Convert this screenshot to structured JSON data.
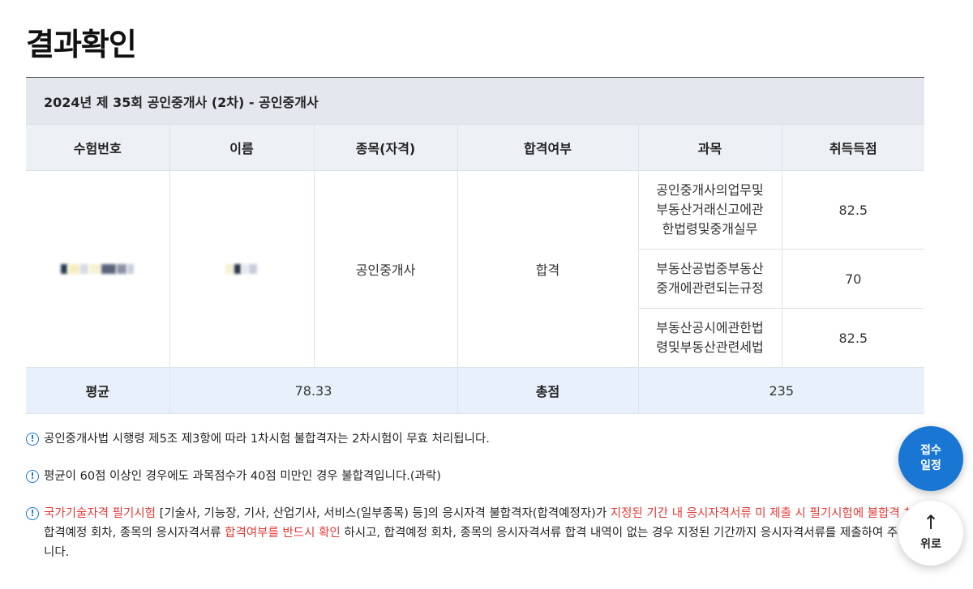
{
  "page": {
    "title": "결과확인"
  },
  "exam": {
    "caption": "2024년 제 35회 공인중개사 (2차) - 공인중개사"
  },
  "table": {
    "headers": [
      "수험번호",
      "이름",
      "종목(자격)",
      "합격여부",
      "과목",
      "취득득점"
    ],
    "result": {
      "license": "공인중개사",
      "pass_status": "합격"
    },
    "subjects": [
      {
        "name": "공인중개사의업무및부동산거래신고에관한법령및중개실무",
        "lines": [
          "공인중개사의업무및",
          "부동산거래신고에관",
          "한법령및중개실무"
        ],
        "score": "82.5"
      },
      {
        "name": "부동산공법중부동산중개에관련되는규정",
        "lines": [
          "부동산공법중부동산",
          "중개에관련되는규정"
        ],
        "score": "70"
      },
      {
        "name": "부동산공시에관한법령및부동산관련세법",
        "lines": [
          "부동산공시에관한법",
          "령및부동산관련세법"
        ],
        "score": "82.5"
      }
    ],
    "summary": {
      "avg_label": "평균",
      "avg_value": "78.33",
      "total_label": "총점",
      "total_value": "235"
    }
  },
  "notes": {
    "note1": "공인중개사법 시행령 제5조 제3항에 따라 1차시험 불합격자는 2차시험이 무효 처리됩니다.",
    "note2": "평균이 60점 이상인 경우에도 과목점수가 40점 미만인 경우 불합격입니다.(과락)",
    "note3": {
      "part1_red": "국가기술자격 필기시험",
      "part2": " [기술사, 기능장, 기사, 산업기사, 서비스(일부종목) 등]의 응시자격 불합격자(합격예정자)가 ",
      "part3_red": "지정된 기간 내 응시자격서류 미 제출 시 필기시험에 불합격 처리됨.",
      "part4": "합격예정 회차, 종목의 응시자격서류 ",
      "part5_red": "합격여부를 반드시 확인",
      "part6": " 하시고, 합격예정 회차, 종목의 응시자격서류 합격 내역이 없는 경우 지정된 기간까지 응시자격서류를 제출하여 주시기 바랍니다."
    }
  },
  "fab": {
    "schedule_line1": "접수",
    "schedule_line2": "일정",
    "top_arrow": "↑",
    "top_label": "위로"
  },
  "icons": {
    "notice": "exclamation-circle-icon",
    "arrow": "arrow-up-icon"
  },
  "colors": {
    "accent": "#1976d2",
    "warning": "#e53935",
    "header_bg": "#edf1f6",
    "summary_bg": "#e8f1fb"
  }
}
